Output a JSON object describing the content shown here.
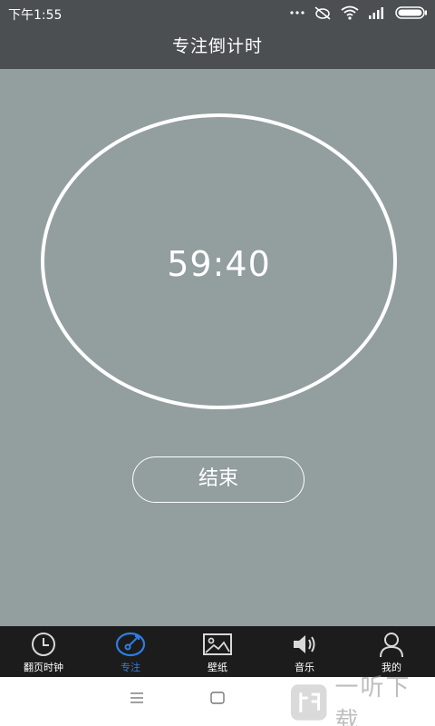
{
  "status_bar": {
    "time": "下午1:55"
  },
  "header": {
    "title": "专注倒计时"
  },
  "timer": {
    "value": "59:40"
  },
  "actions": {
    "end_label": "结束"
  },
  "tabs": [
    {
      "label": "翻页时钟",
      "icon": "clock-icon",
      "active": false
    },
    {
      "label": "专注",
      "icon": "focus-target-icon",
      "active": true
    },
    {
      "label": "壁纸",
      "icon": "image-icon",
      "active": false
    },
    {
      "label": "音乐",
      "icon": "speaker-icon",
      "active": false
    },
    {
      "label": "我的",
      "icon": "user-icon",
      "active": false
    }
  ],
  "watermark": {
    "text": "一听下载"
  },
  "colors": {
    "background": "#939e9e",
    "header": "#4b4f52",
    "tabbar": "#1c1c1d",
    "accent": "#2f7de1"
  }
}
